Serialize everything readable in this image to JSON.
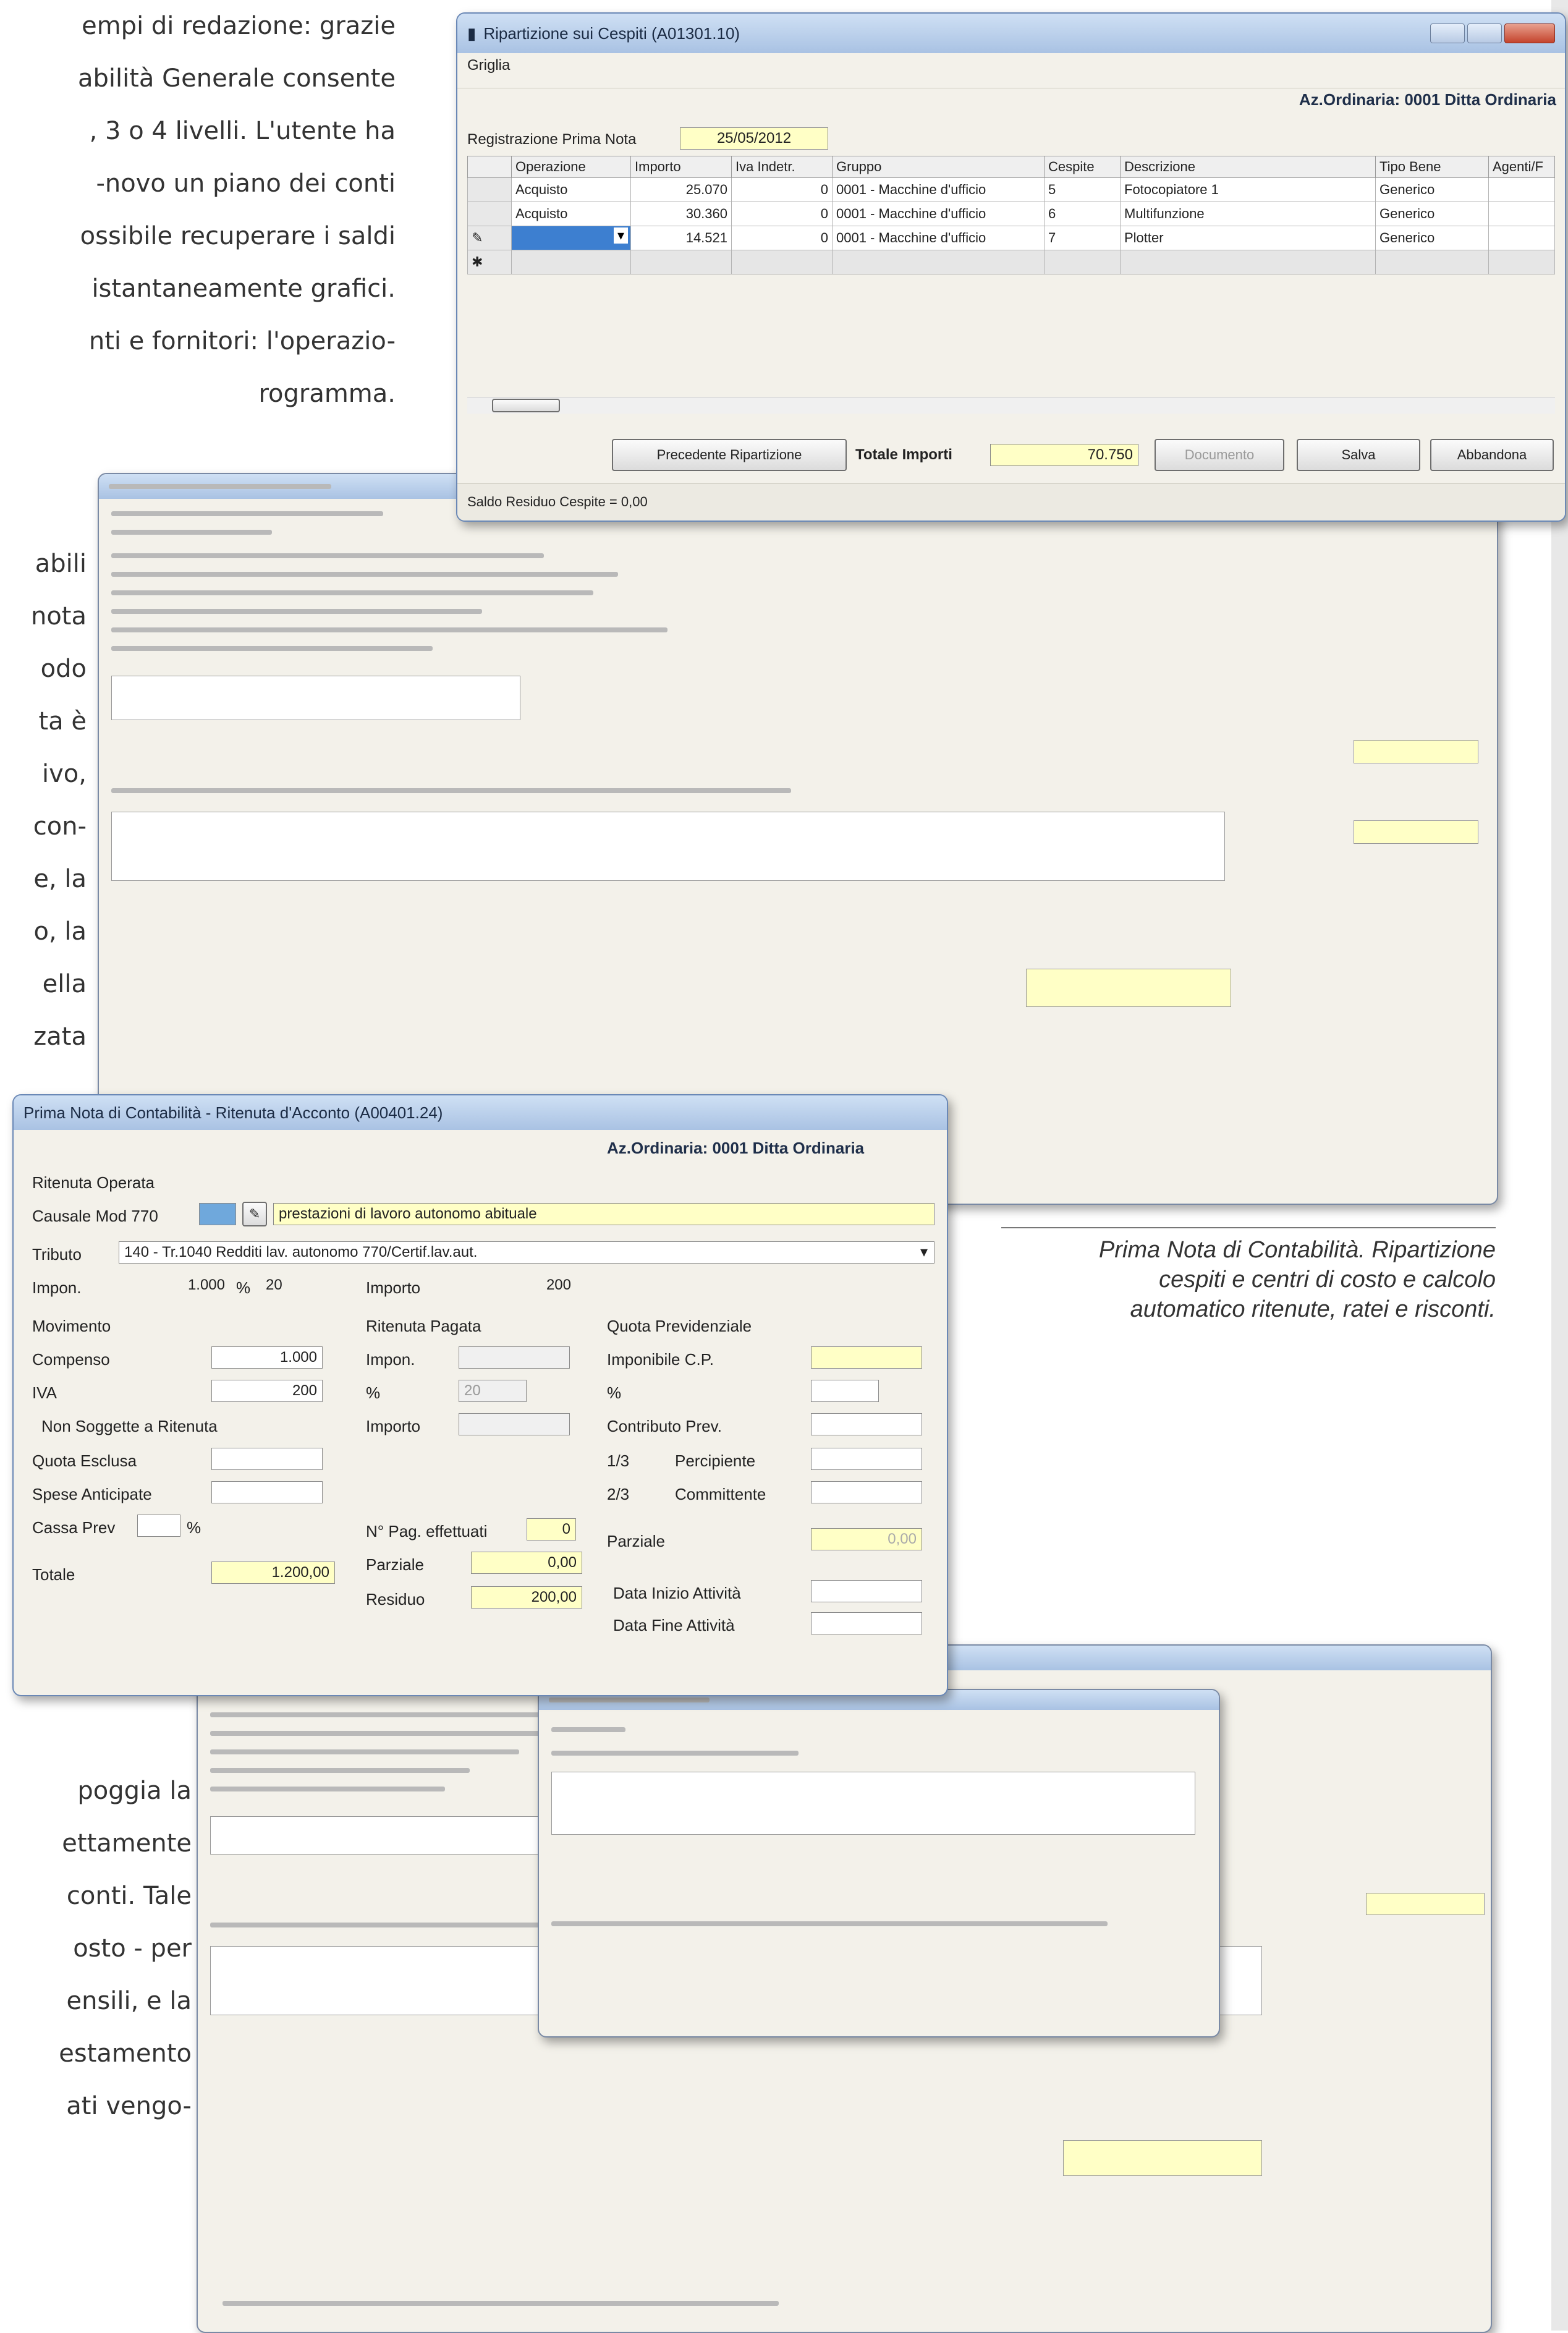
{
  "page": {
    "body_text_top": [
      "empi di redazione: grazie",
      "abilità Generale consente",
      ", 3 o 4 livelli. L'utente ha",
      "-novo un piano dei conti",
      "ossibile recuperare i saldi",
      "istantaneamente grafici.",
      "nti e fornitori: l'operazio-",
      "rogramma."
    ],
    "body_text_mid": [
      "abili",
      "nota",
      "odo",
      "ta è",
      "ivo,",
      "con-",
      "e, la",
      "o, la",
      "ella",
      "zata"
    ],
    "body_text_bottom": [
      "poggia la",
      "ettamente",
      "conti. Tale",
      "osto - per",
      "ensili, e la",
      "estamento",
      "ati vengo-"
    ],
    "caption": [
      "Prima Nota di Contabilità. Ripartizione",
      "cespiti e centri di costo e calcolo",
      "automatico ritenute, ratei e risconti."
    ]
  },
  "window_cespiti": {
    "title": "Ripartizione sui Cespiti (A01301.10)",
    "menu": "Griglia",
    "company": "Az.Ordinaria: 0001 Ditta Ordinaria",
    "reg_label": "Registrazione Prima Nota",
    "reg_date": "25/05/2012",
    "columns": [
      "Operazione",
      "Importo",
      "Iva Indetr.",
      "Gruppo",
      "Cespite",
      "Descrizione",
      "Tipo Bene",
      "Agenti/F"
    ],
    "rows": [
      {
        "marker": "",
        "op": "Acquisto",
        "importo": "25.070",
        "iva": "0",
        "gruppo": "0001 - Macchine d'ufficio",
        "cespite": "5",
        "descr": "Fotocopiatore 1",
        "tipo": "Generico"
      },
      {
        "marker": "",
        "op": "Acquisto",
        "importo": "30.360",
        "iva": "0",
        "gruppo": "0001 - Macchine d'ufficio",
        "cespite": "6",
        "descr": "Multifunzione",
        "tipo": "Generico"
      },
      {
        "marker": "✎",
        "op": "",
        "importo": "14.521",
        "iva": "0",
        "gruppo": "0001 - Macchine d'ufficio",
        "cespite": "7",
        "descr": "Plotter",
        "tipo": "Generico"
      },
      {
        "marker": "✱",
        "op": "",
        "importo": "",
        "iva": "",
        "gruppo": "",
        "cespite": "",
        "descr": "",
        "tipo": ""
      }
    ],
    "btn_prev": "Precedente Ripartizione",
    "total_label": "Totale Importi",
    "total_value": "70.750",
    "btn_disabled": "Documento",
    "btn_save": "Salva",
    "btn_cancel": "Abbandona",
    "footer": "Saldo Residuo Cespite = 0,00"
  },
  "window_ritenuta": {
    "title": "Prima Nota di Contabilità  -  Ritenuta d'Acconto  (A00401.24)",
    "company": "Az.Ordinaria: 0001 Ditta Ordinaria",
    "ritenuta_operata": "Ritenuta Operata",
    "causale_label": "Causale Mod 770",
    "causale_text": "prestazioni di lavoro autonomo abituale",
    "tributo_label": "Tributo",
    "tributo_value": "140 - Tr.1040 Redditi lav. autonomo 770/Certif.lav.aut.",
    "impon_label": "Impon.",
    "impon_value": "1.000",
    "pct_symbol": "%",
    "pct_value": "20",
    "importo_label": "Importo",
    "importo_value": "200",
    "movimento": "Movimento",
    "compenso_label": "Compenso",
    "compenso_value": "1.000",
    "iva_label": "IVA",
    "iva_value": "200",
    "non_sogg": "Non Soggette a Ritenuta",
    "quota_escl": "Quota Esclusa",
    "spese_ant": "Spese Anticipate",
    "cassa_prev": "Cassa Prev",
    "totale_label": "Totale",
    "totale_value": "1.200,00",
    "rit_pagata": "Ritenuta Pagata",
    "impon2": "Impon.",
    "pct2": "%",
    "pct2_value": "20",
    "importo2": "Importo",
    "npag_label": "N° Pag. effettuati",
    "npag_value": "0",
    "parziale_label": "Parziale",
    "parziale_value": "0,00",
    "residuo_label": "Residuo",
    "residuo_value": "200,00",
    "quota_prev": "Quota Previdenziale",
    "imponibile_cp": "Imponibile C.P.",
    "pct3": "%",
    "contributo": "Contributo Prev.",
    "percipiente_frac": "1/3",
    "percipiente": "Percipiente",
    "committente_frac": "2/3",
    "committente": "Committente",
    "parziale2": "Parziale",
    "parziale2_value": "0,00",
    "data_inizio": "Data Inizio Attività",
    "data_fine": "Data Fine Attività"
  }
}
